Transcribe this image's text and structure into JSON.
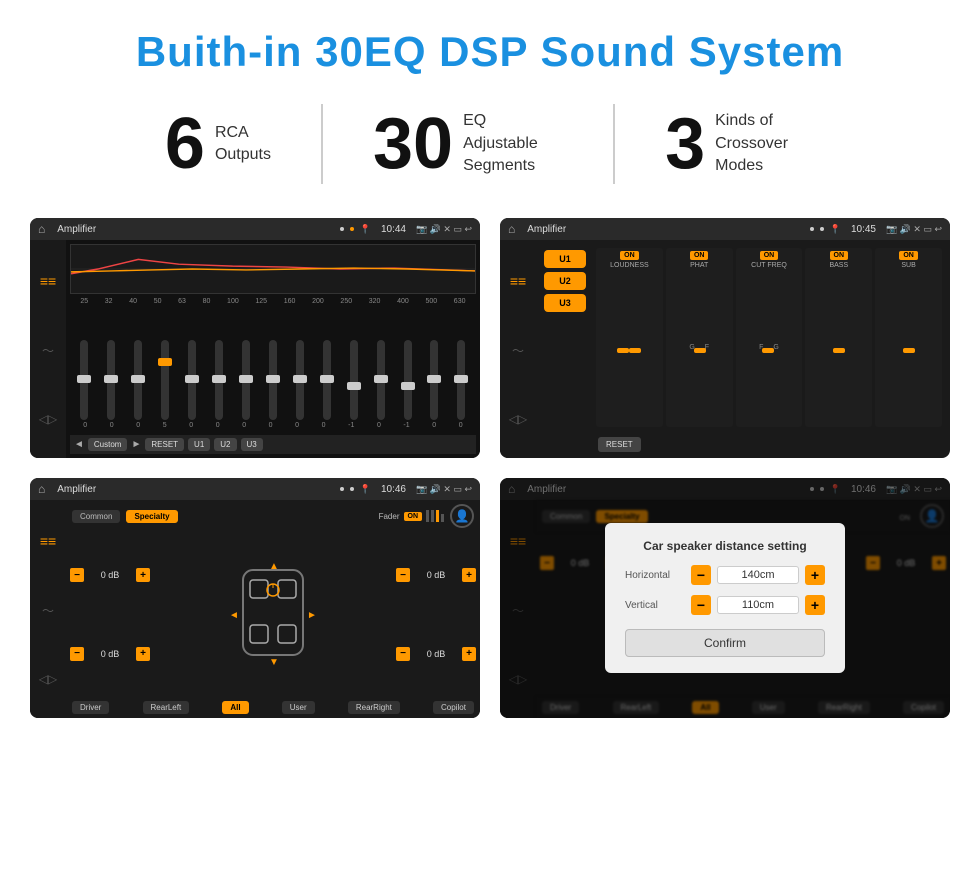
{
  "page": {
    "title": "Buith-in 30EQ DSP Sound System"
  },
  "stats": [
    {
      "number": "6",
      "text_line1": "RCA",
      "text_line2": "Outputs"
    },
    {
      "number": "30",
      "text_line1": "EQ Adjustable",
      "text_line2": "Segments"
    },
    {
      "number": "3",
      "text_line1": "Kinds of",
      "text_line2": "Crossover Modes"
    }
  ],
  "screen1": {
    "status_title": "Amplifier",
    "time": "10:44",
    "eq_labels": [
      "25",
      "32",
      "40",
      "50",
      "63",
      "80",
      "100",
      "125",
      "160",
      "200",
      "250",
      "320",
      "400",
      "500",
      "630"
    ],
    "eq_values": [
      "0",
      "0",
      "0",
      "5",
      "0",
      "0",
      "0",
      "0",
      "0",
      "0",
      "-1",
      "0",
      "-1"
    ],
    "buttons": [
      "Custom",
      "RESET",
      "U1",
      "U2",
      "U3"
    ]
  },
  "screen2": {
    "status_title": "Amplifier",
    "time": "10:45",
    "u_buttons": [
      "U1",
      "U2",
      "U3"
    ],
    "modules": [
      {
        "on": true,
        "label": "LOUDNESS"
      },
      {
        "on": true,
        "label": "PHAT"
      },
      {
        "on": true,
        "label": "CUT FREQ"
      },
      {
        "on": true,
        "label": "BASS"
      },
      {
        "on": true,
        "label": "SUB"
      }
    ],
    "reset_label": "RESET"
  },
  "screen3": {
    "status_title": "Amplifier",
    "time": "10:46",
    "tabs": [
      "Common",
      "Specialty"
    ],
    "active_tab": "Specialty",
    "fader_label": "Fader",
    "fader_on": "ON",
    "db_values": [
      "0 dB",
      "0 dB",
      "0 dB",
      "0 dB"
    ],
    "bottom_buttons": [
      "Driver",
      "RearLeft",
      "All",
      "User",
      "RearRight",
      "Copilot"
    ]
  },
  "screen4": {
    "status_title": "Amplifier",
    "time": "10:46",
    "tabs": [
      "Common",
      "Specialty"
    ],
    "dialog": {
      "title": "Car speaker distance setting",
      "horizontal_label": "Horizontal",
      "horizontal_value": "140cm",
      "vertical_label": "Vertical",
      "vertical_value": "110cm",
      "confirm_label": "Confirm"
    },
    "bottom_buttons": [
      "Driver",
      "RearLeft",
      "All",
      "User",
      "RearRight",
      "Copilot"
    ]
  }
}
